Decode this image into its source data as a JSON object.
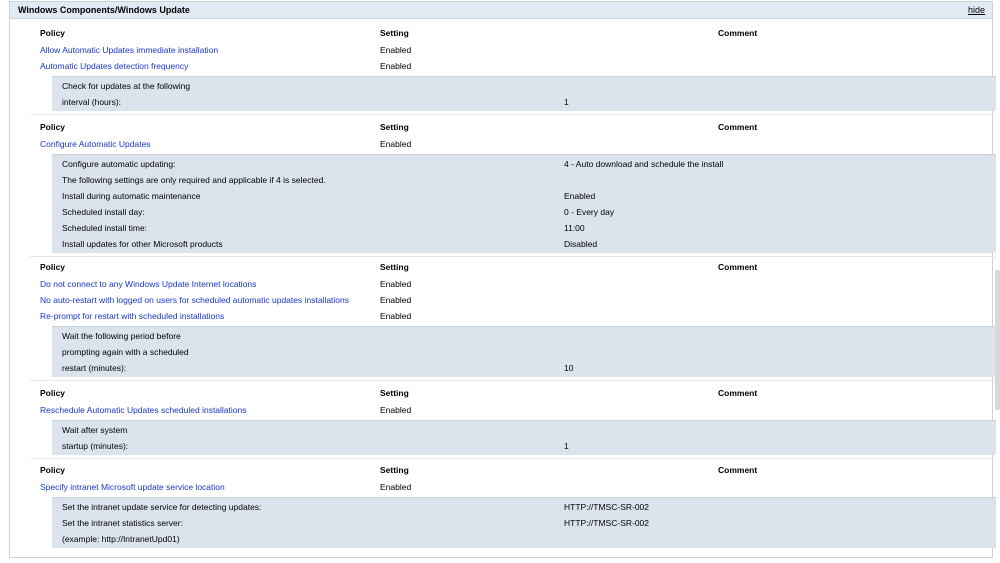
{
  "header": {
    "title": "Windows Components/Windows Update",
    "hide_label": "hide"
  },
  "columns": {
    "policy": "Policy",
    "setting": "Setting",
    "comment": "Comment"
  },
  "sections": [
    {
      "policies": [
        {
          "name": "Allow Automatic Updates immediate installation",
          "setting": "Enabled"
        },
        {
          "name": "Automatic Updates detection frequency",
          "setting": "Enabled"
        }
      ],
      "details": [
        {
          "label": "Check for updates at the following",
          "value": ""
        },
        {
          "label": "interval (hours):",
          "value": "1"
        }
      ]
    },
    {
      "policies": [
        {
          "name": "Configure Automatic Updates",
          "setting": "Enabled"
        }
      ],
      "details": [
        {
          "label": "Configure automatic updating:",
          "value": "4 - Auto download and schedule the install"
        },
        {
          "label": "The following settings are only required and applicable if 4 is selected.",
          "value": ""
        },
        {
          "label": "Install during automatic maintenance",
          "value": "Enabled"
        },
        {
          "label": "Scheduled install day:",
          "value": "0 - Every day"
        },
        {
          "label": "Scheduled install time:",
          "value": "11:00"
        },
        {
          "label": "Install updates for other Microsoft products",
          "value": "Disabled"
        }
      ]
    },
    {
      "policies": [
        {
          "name": "Do not connect to any Windows Update Internet locations",
          "setting": "Enabled"
        },
        {
          "name": "No auto-restart with logged on users for scheduled automatic updates installations",
          "setting": "Enabled"
        },
        {
          "name": "Re-prompt for restart with scheduled installations",
          "setting": "Enabled"
        }
      ],
      "details": [
        {
          "label": "Wait the following period before",
          "value": ""
        },
        {
          "label": "prompting again with a scheduled",
          "value": ""
        },
        {
          "label": "restart (minutes):",
          "value": "10"
        }
      ]
    },
    {
      "policies": [
        {
          "name": "Reschedule Automatic Updates scheduled installations",
          "setting": "Enabled"
        }
      ],
      "details": [
        {
          "label": "Wait after system",
          "value": ""
        },
        {
          "label": "startup (minutes):",
          "value": "1"
        }
      ]
    },
    {
      "policies": [
        {
          "name": "Specify intranet Microsoft update service location",
          "setting": "Enabled"
        }
      ],
      "details": [
        {
          "label": "Set the intranet update service for detecting updates:",
          "value": "HTTP://TMSC-SR-002"
        },
        {
          "label": "Set the intranet statistics server:",
          "value": "HTTP://TMSC-SR-002"
        },
        {
          "label": "(example: http://IntranetUpd01)",
          "value": ""
        }
      ]
    }
  ]
}
